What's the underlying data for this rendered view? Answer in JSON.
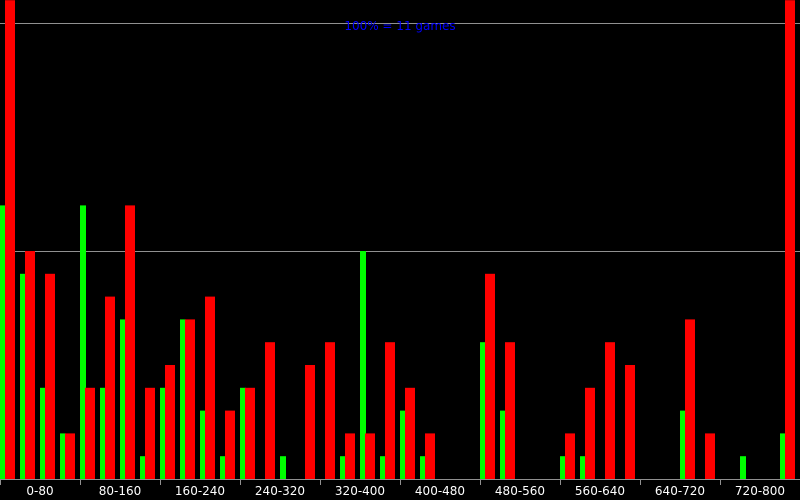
{
  "chart_data": {
    "type": "bar",
    "annotation": "100% = 11 games",
    "categories": [
      "0-80",
      "80-160",
      "160-240",
      "240-320",
      "320-400",
      "400-480",
      "480-560",
      "560-640",
      "640-720",
      "720-800"
    ],
    "ylim": [
      0,
      100
    ],
    "grid": true,
    "series": [
      {
        "color": "#00ff00",
        "values": [
          60,
          45,
          20,
          10,
          60,
          20,
          35,
          5,
          20,
          35,
          15,
          5,
          20,
          0,
          5,
          0,
          0,
          5,
          50,
          5,
          15,
          5,
          0,
          0,
          30,
          15,
          0,
          0,
          5,
          5,
          0,
          0,
          0,
          0,
          15,
          0,
          0,
          5,
          0,
          10
        ]
      },
      {
        "color": "#ff0000",
        "values": [
          105,
          50,
          45,
          10,
          20,
          40,
          60,
          20,
          25,
          35,
          40,
          15,
          20,
          30,
          0,
          25,
          30,
          10,
          10,
          30,
          20,
          10,
          0,
          0,
          45,
          30,
          0,
          0,
          10,
          20,
          30,
          25,
          0,
          0,
          35,
          10,
          0,
          0,
          0,
          105
        ]
      }
    ]
  }
}
